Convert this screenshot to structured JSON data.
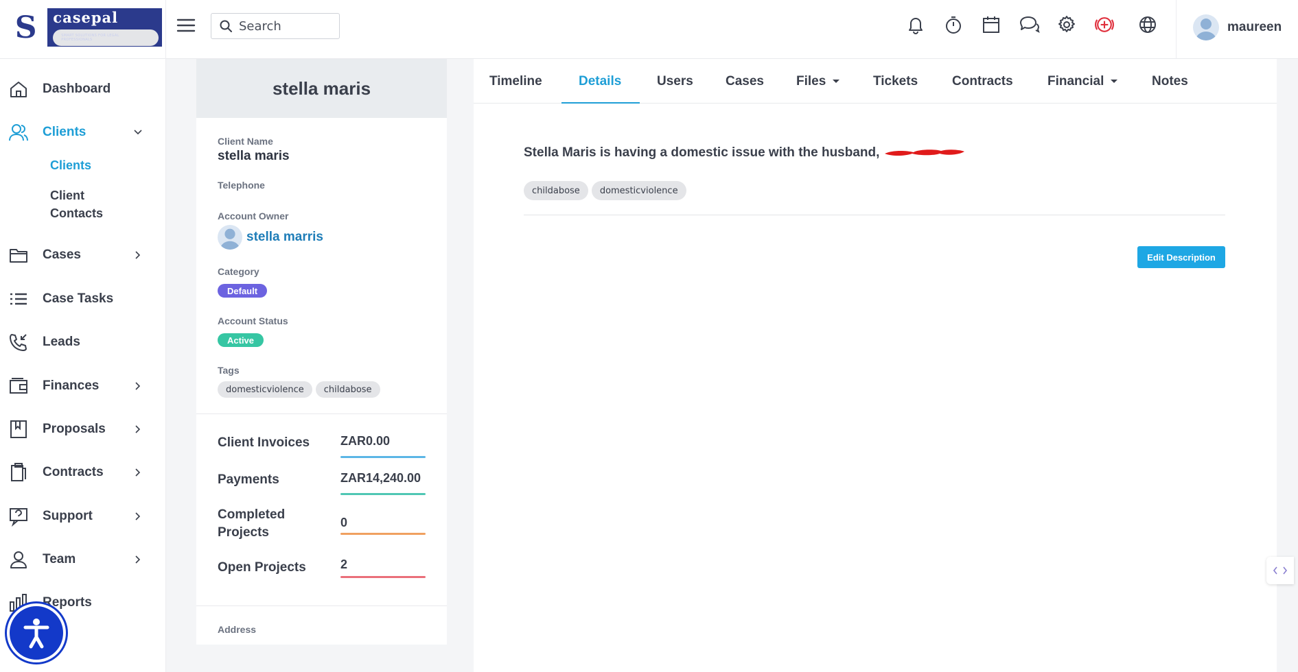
{
  "brand": {
    "logo_mark": "S",
    "name": "casepal",
    "tagline": "SMART SOLUTIONS FOR LEGAL PROFESSIONALS"
  },
  "topbar": {
    "search_placeholder": "Search",
    "icons": [
      "bell-icon",
      "stopwatch-icon",
      "calendar-icon",
      "chat-icon",
      "gear-icon",
      "add-circle-icon",
      "globe-icon"
    ],
    "user_name": "maureen"
  },
  "sidebar": {
    "items": [
      {
        "label": "Dashboard",
        "icon": "home-icon"
      },
      {
        "label": "Clients",
        "icon": "users-icon",
        "expanded": true
      },
      {
        "label": "Cases",
        "icon": "folder-icon"
      },
      {
        "label": "Case Tasks",
        "icon": "list-icon"
      },
      {
        "label": "Leads",
        "icon": "phone-incoming-icon"
      },
      {
        "label": "Finances",
        "icon": "wallet-icon"
      },
      {
        "label": "Proposals",
        "icon": "bookmark-book-icon"
      },
      {
        "label": "Contracts",
        "icon": "clipboard-icon"
      },
      {
        "label": "Support",
        "icon": "support-chat-icon"
      },
      {
        "label": "Team",
        "icon": "person-icon"
      },
      {
        "label": "Reports",
        "icon": "bar-chart-icon"
      }
    ],
    "sub_items": [
      "Clients",
      "Client Contacts"
    ]
  },
  "client": {
    "header_name": "stella maris",
    "client_name_label": "Client Name",
    "client_name": "stella maris",
    "telephone_label": "Telephone",
    "account_owner_label": "Account Owner",
    "account_owner": "stella marris",
    "category_label": "Category",
    "category": "Default",
    "account_status_label": "Account Status",
    "account_status": "Active",
    "tags_label": "Tags",
    "tags": [
      "domesticviolence",
      "childabose"
    ],
    "address_label": "Address"
  },
  "stats": [
    {
      "label": "Client Invoices",
      "value": "ZAR0.00",
      "color": "#5bb6e6"
    },
    {
      "label": "Payments",
      "value": "ZAR14,240.00",
      "color": "#4fc7b4"
    },
    {
      "label": "Completed Projects",
      "value": "0",
      "color": "#f0a060"
    },
    {
      "label": "Open Projects",
      "value": "2",
      "color": "#ea6f7a"
    }
  ],
  "tabs": [
    "Timeline",
    "Details",
    "Users",
    "Cases",
    "Files",
    "Tickets",
    "Contracts",
    "Financial",
    "Notes"
  ],
  "active_tab": "Details",
  "details": {
    "description": "Stella Maris is having a domestic issue with the husband,",
    "tags": [
      "childabose",
      "domesticviolence"
    ],
    "edit_button": "Edit Description"
  },
  "colors": {
    "accent": "#1e9ed6",
    "category_badge": "#6c63e0",
    "status_badge": "#36c6a3",
    "a11y_button": "#1339c9"
  }
}
